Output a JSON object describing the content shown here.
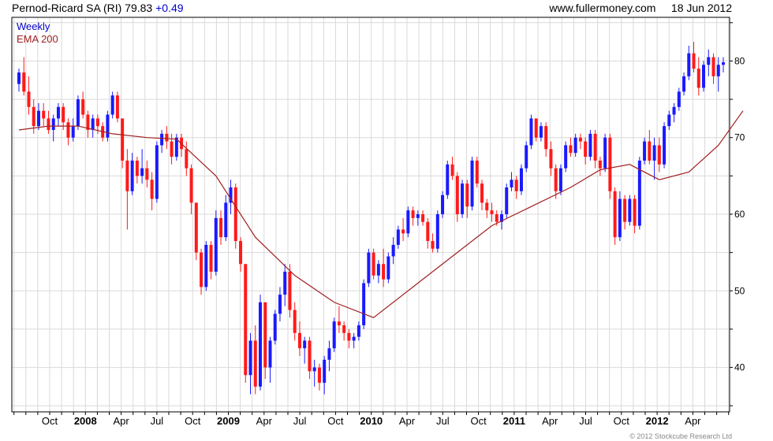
{
  "header": {
    "title": "Pernod-Ricard SA (RI)",
    "price": "79.83",
    "change": "+0.49",
    "site": "www.fullermoney.com",
    "date": "18 Jun 2012"
  },
  "footer": {
    "copyright": "© 2012 Stockcube Research Ltd"
  },
  "colors": {
    "up": "#1a1aff",
    "down": "#ff1a1a",
    "ema": "#a02020",
    "grid": "#d9d9d9",
    "legend_weekly": "#0000cc",
    "legend_ema": "#a02020"
  },
  "chart_data": {
    "type": "candlestick",
    "legend": [
      "Weekly",
      "EMA 200"
    ],
    "legend_position": "top-left",
    "y_axis": {
      "side": "right",
      "ticks": [
        40,
        50,
        60,
        70,
        80
      ],
      "range": [
        34.2,
        85.7
      ]
    },
    "x_axis": {
      "tick_labels": [
        "Oct",
        "2008",
        "Apr",
        "Jul",
        "Oct",
        "2009",
        "Apr",
        "Jul",
        "Oct",
        "2010",
        "Apr",
        "Jul",
        "Oct",
        "2011",
        "Apr",
        "Jul",
        "Oct",
        "2012",
        "Apr"
      ],
      "bold_labels": [
        "2008",
        "2009",
        "2010",
        "2011",
        "2012"
      ],
      "minor_ticks_per_label": 3
    },
    "grid": true,
    "series": [
      {
        "name": "Weekly",
        "kind": "ohlc",
        "columns": [
          "open",
          "high",
          "low",
          "close"
        ],
        "values": [
          [
            77.0,
            79.0,
            76.0,
            78.5
          ],
          [
            78.5,
            80.5,
            75.5,
            76.0
          ],
          [
            76.0,
            78.0,
            73.0,
            74.0
          ],
          [
            74.0,
            75.0,
            70.5,
            71.5
          ],
          [
            71.5,
            74.5,
            71.0,
            73.5
          ],
          [
            73.5,
            74.5,
            71.5,
            72.5
          ],
          [
            72.5,
            73.5,
            70.5,
            71.0
          ],
          [
            71.0,
            73.0,
            69.5,
            72.5
          ],
          [
            72.5,
            74.5,
            71.5,
            74.0
          ],
          [
            74.0,
            74.5,
            71.0,
            72.0
          ],
          [
            72.0,
            72.5,
            69.0,
            70.0
          ],
          [
            70.0,
            72.5,
            69.5,
            71.5
          ],
          [
            71.5,
            75.5,
            71.0,
            75.0
          ],
          [
            75.0,
            76.0,
            72.5,
            73.0
          ],
          [
            73.0,
            73.5,
            70.0,
            71.0
          ],
          [
            71.0,
            73.0,
            70.0,
            72.5
          ],
          [
            72.5,
            73.0,
            70.5,
            71.5
          ],
          [
            71.5,
            72.0,
            69.5,
            70.0
          ],
          [
            70.0,
            73.5,
            69.5,
            73.0
          ],
          [
            73.0,
            76.0,
            72.5,
            75.5
          ],
          [
            75.5,
            76.0,
            72.0,
            72.5
          ],
          [
            72.5,
            72.5,
            66.0,
            67.0
          ],
          [
            67.0,
            68.5,
            58.0,
            63.0
          ],
          [
            63.0,
            68.0,
            62.5,
            67.0
          ],
          [
            67.0,
            67.5,
            64.0,
            65.0
          ],
          [
            65.0,
            68.5,
            64.0,
            66.0
          ],
          [
            66.0,
            67.0,
            63.5,
            64.5
          ],
          [
            64.5,
            65.5,
            60.5,
            62.0
          ],
          [
            62.0,
            69.5,
            61.5,
            69.0
          ],
          [
            69.0,
            71.0,
            68.0,
            70.5
          ],
          [
            70.5,
            71.5,
            68.5,
            69.5
          ],
          [
            69.5,
            70.5,
            66.5,
            67.5
          ],
          [
            67.5,
            70.5,
            67.0,
            70.0
          ],
          [
            70.0,
            70.5,
            67.5,
            68.5
          ],
          [
            68.5,
            69.5,
            65.0,
            66.0
          ],
          [
            66.0,
            66.5,
            60.0,
            61.5
          ],
          [
            61.5,
            61.5,
            54.0,
            55.0
          ],
          [
            55.0,
            55.5,
            49.5,
            50.5
          ],
          [
            50.5,
            56.5,
            50.0,
            56.0
          ],
          [
            56.0,
            56.5,
            51.5,
            52.5
          ],
          [
            52.5,
            60.5,
            52.0,
            59.5
          ],
          [
            59.5,
            60.5,
            56.0,
            57.0
          ],
          [
            57.0,
            62.5,
            56.5,
            61.5
          ],
          [
            61.5,
            64.5,
            60.0,
            63.5
          ],
          [
            63.5,
            64.0,
            55.5,
            56.5
          ],
          [
            56.5,
            57.0,
            52.5,
            53.5
          ],
          [
            53.5,
            53.5,
            38.0,
            39.0
          ],
          [
            39.0,
            44.5,
            36.5,
            43.5
          ],
          [
            43.5,
            45.5,
            36.5,
            37.5
          ],
          [
            37.5,
            49.5,
            37.0,
            48.5
          ],
          [
            48.5,
            48.5,
            38.5,
            40.0
          ],
          [
            40.0,
            44.0,
            38.0,
            43.5
          ],
          [
            43.5,
            47.5,
            43.0,
            47.0
          ],
          [
            47.0,
            50.5,
            46.0,
            49.5
          ],
          [
            49.5,
            53.5,
            48.0,
            52.5
          ],
          [
            52.5,
            53.5,
            46.5,
            47.5
          ],
          [
            47.5,
            48.5,
            43.5,
            44.5
          ],
          [
            44.5,
            46.0,
            41.5,
            42.5
          ],
          [
            42.5,
            44.0,
            40.5,
            43.5
          ],
          [
            43.5,
            44.0,
            38.5,
            39.5
          ],
          [
            39.5,
            41.0,
            37.5,
            40.0
          ],
          [
            40.0,
            40.5,
            37.0,
            38.0
          ],
          [
            38.0,
            41.5,
            36.5,
            41.0
          ],
          [
            41.0,
            43.5,
            39.5,
            42.5
          ],
          [
            42.5,
            46.5,
            42.0,
            46.0
          ],
          [
            46.0,
            48.0,
            44.5,
            45.5
          ],
          [
            45.5,
            46.0,
            43.5,
            44.5
          ],
          [
            44.5,
            45.0,
            42.5,
            43.5
          ],
          [
            43.5,
            44.5,
            42.5,
            44.0
          ],
          [
            44.0,
            46.0,
            43.5,
            45.5
          ],
          [
            45.5,
            51.5,
            45.0,
            51.0
          ],
          [
            51.0,
            55.5,
            50.5,
            55.0
          ],
          [
            55.0,
            55.5,
            51.5,
            52.0
          ],
          [
            52.0,
            54.0,
            51.0,
            53.5
          ],
          [
            53.5,
            55.5,
            50.5,
            51.5
          ],
          [
            51.5,
            55.0,
            51.0,
            54.5
          ],
          [
            54.5,
            57.0,
            53.5,
            56.0
          ],
          [
            56.0,
            58.5,
            55.5,
            58.0
          ],
          [
            58.0,
            59.5,
            56.5,
            57.5
          ],
          [
            57.5,
            61.0,
            57.0,
            60.5
          ],
          [
            60.5,
            61.0,
            58.5,
            59.5
          ],
          [
            59.5,
            60.5,
            58.5,
            60.0
          ],
          [
            60.0,
            60.5,
            58.5,
            59.0
          ],
          [
            59.0,
            59.5,
            55.5,
            56.5
          ],
          [
            56.5,
            57.5,
            55.0,
            55.5
          ],
          [
            55.5,
            60.5,
            55.0,
            60.0
          ],
          [
            60.0,
            63.0,
            59.5,
            62.5
          ],
          [
            62.5,
            67.0,
            62.0,
            66.5
          ],
          [
            66.5,
            67.5,
            64.5,
            65.0
          ],
          [
            65.0,
            65.5,
            59.0,
            60.0
          ],
          [
            60.0,
            64.5,
            59.5,
            64.0
          ],
          [
            64.0,
            64.5,
            59.5,
            61.0
          ],
          [
            61.0,
            67.5,
            60.5,
            67.0
          ],
          [
            67.0,
            67.5,
            63.5,
            64.0
          ],
          [
            64.0,
            64.5,
            60.5,
            61.5
          ],
          [
            61.5,
            62.0,
            59.5,
            60.5
          ],
          [
            60.5,
            61.5,
            59.0,
            60.0
          ],
          [
            60.0,
            60.5,
            58.5,
            59.0
          ],
          [
            59.0,
            60.5,
            58.0,
            60.0
          ],
          [
            60.0,
            64.0,
            59.5,
            63.5
          ],
          [
            63.5,
            65.5,
            63.0,
            64.5
          ],
          [
            64.5,
            65.0,
            62.0,
            63.0
          ],
          [
            63.0,
            66.5,
            62.5,
            66.0
          ],
          [
            66.0,
            69.5,
            65.5,
            69.0
          ],
          [
            69.0,
            73.0,
            68.5,
            72.5
          ],
          [
            72.5,
            72.5,
            69.5,
            70.0
          ],
          [
            70.0,
            72.0,
            69.5,
            71.5
          ],
          [
            71.5,
            72.0,
            67.5,
            68.5
          ],
          [
            68.5,
            69.5,
            65.0,
            66.0
          ],
          [
            66.0,
            66.5,
            62.0,
            63.0
          ],
          [
            63.0,
            66.5,
            62.5,
            66.0
          ],
          [
            66.0,
            69.5,
            65.5,
            69.0
          ],
          [
            69.0,
            70.0,
            67.5,
            68.0
          ],
          [
            68.0,
            70.5,
            67.5,
            70.0
          ],
          [
            70.0,
            70.5,
            68.5,
            69.5
          ],
          [
            69.5,
            70.0,
            66.5,
            67.5
          ],
          [
            67.5,
            71.0,
            67.0,
            70.5
          ],
          [
            70.5,
            71.0,
            66.0,
            67.0
          ],
          [
            67.0,
            67.5,
            65.0,
            66.0
          ],
          [
            66.0,
            70.5,
            65.5,
            70.0
          ],
          [
            70.0,
            70.5,
            62.0,
            63.0
          ],
          [
            63.0,
            63.5,
            56.0,
            57.0
          ],
          [
            57.0,
            63.0,
            56.5,
            62.0
          ],
          [
            62.0,
            62.5,
            58.0,
            59.0
          ],
          [
            59.0,
            62.5,
            58.5,
            62.0
          ],
          [
            62.0,
            62.5,
            57.5,
            58.5
          ],
          [
            58.5,
            67.5,
            58.0,
            67.0
          ],
          [
            67.0,
            70.0,
            66.5,
            69.5
          ],
          [
            69.5,
            71.0,
            66.5,
            67.0
          ],
          [
            67.0,
            70.0,
            64.5,
            69.0
          ],
          [
            69.0,
            70.0,
            65.5,
            66.5
          ],
          [
            66.5,
            72.0,
            66.0,
            71.5
          ],
          [
            71.5,
            73.5,
            71.0,
            73.0
          ],
          [
            73.0,
            74.5,
            72.0,
            74.0
          ],
          [
            74.0,
            76.5,
            73.5,
            76.0
          ],
          [
            76.0,
            78.5,
            75.5,
            78.0
          ],
          [
            78.0,
            82.0,
            77.5,
            81.0
          ],
          [
            81.0,
            82.5,
            78.5,
            79.0
          ],
          [
            79.0,
            80.5,
            75.5,
            76.5
          ],
          [
            76.5,
            80.0,
            76.0,
            79.5
          ],
          [
            79.5,
            81.5,
            78.0,
            80.5
          ],
          [
            80.5,
            81.0,
            77.0,
            78.0
          ],
          [
            78.0,
            80.5,
            76.0,
            79.5
          ],
          [
            79.5,
            80.5,
            78.5,
            79.83
          ]
        ]
      },
      {
        "name": "EMA 200",
        "kind": "line",
        "anchors": [
          [
            0,
            71.0
          ],
          [
            6,
            71.5
          ],
          [
            12,
            71.5
          ],
          [
            19,
            70.5
          ],
          [
            26,
            70.0
          ],
          [
            32,
            69.8
          ],
          [
            40,
            65.0
          ],
          [
            48,
            57.0
          ],
          [
            56,
            52.0
          ],
          [
            64,
            48.5
          ],
          [
            72,
            46.5
          ],
          [
            80,
            50.5
          ],
          [
            88,
            54.5
          ],
          [
            96,
            58.5
          ],
          [
            104,
            61.0
          ],
          [
            112,
            63.5
          ],
          [
            118,
            65.8
          ],
          [
            124,
            66.5
          ],
          [
            130,
            64.5
          ],
          [
            136,
            65.5
          ],
          [
            142,
            69.0
          ],
          [
            147,
            73.5
          ]
        ]
      }
    ]
  }
}
